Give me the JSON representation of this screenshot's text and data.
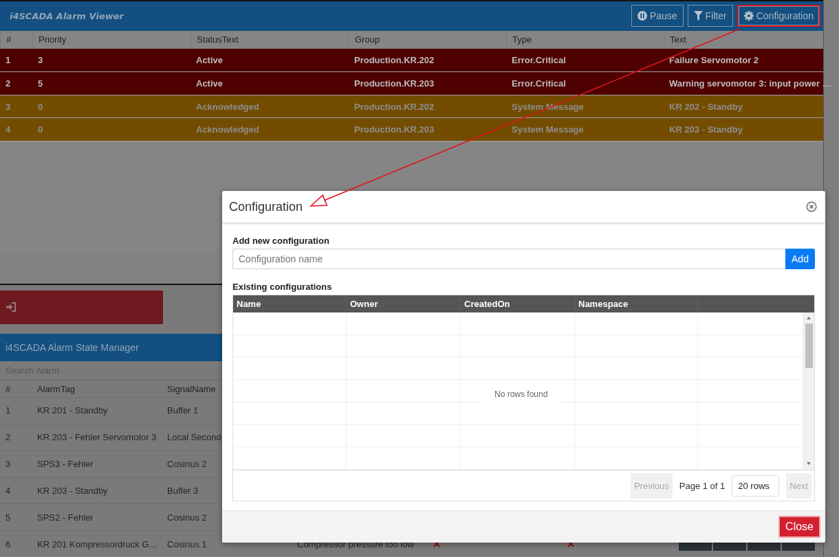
{
  "alarm_viewer": {
    "title": "i4SCADA Alarm Viewer",
    "toolbar": [
      {
        "label": "Pause",
        "kind": "pause",
        "highlighted": false
      },
      {
        "label": "Filter",
        "kind": "filter",
        "highlighted": false
      },
      {
        "label": "Configuration",
        "kind": "settings",
        "highlighted": true
      }
    ],
    "columns": [
      "#",
      "Priority",
      "StatusText",
      "Group",
      "Type",
      "Text"
    ],
    "rows": [
      {
        "kind": "critical",
        "cells": [
          "1",
          "3",
          "Active",
          "Production.KR.202",
          "Error.Critical",
          "Failure Servomotor 2"
        ]
      },
      {
        "kind": "critical",
        "cells": [
          "2",
          "5",
          "Active",
          "Production.KR.203",
          "Error.Critical",
          "Warning servomotor 3: input power …"
        ]
      },
      {
        "kind": "message",
        "cells": [
          "3",
          "0",
          "Acknowledged",
          "Production.KR.202",
          "System Message",
          "KR 202 - Standby"
        ]
      },
      {
        "kind": "message",
        "cells": [
          "4",
          "0",
          "Acknowledged",
          "Production.KR.203",
          "System Message",
          "KR 203 - Standby"
        ]
      }
    ]
  },
  "state_manager": {
    "title": "i4SCADA Alarm State Manager",
    "search": {
      "placeholder": "Search Alarm"
    },
    "columns": [
      "#",
      "AlarmTag",
      "SignalName"
    ],
    "rows": [
      {
        "cells": [
          "1",
          "KR 201 - Standby",
          "Buffer 1"
        ]
      },
      {
        "cells": [
          "2",
          "KR 203 - Fehler Servomotor 3",
          "Local Second"
        ]
      },
      {
        "cells": [
          "3",
          "SPS3 - Fehler",
          "Cosinus 2"
        ]
      },
      {
        "cells": [
          "4",
          "KR 203 - Standby",
          "Buffer 3"
        ]
      },
      {
        "cells": [
          "5",
          "SPS2 - Fehler",
          "Cosinus 2"
        ]
      },
      {
        "cells": [
          "6",
          "KR 201 Kompressordruck G…",
          "Cosinus 1"
        ],
        "message": "Compressor pressure too low",
        "mode_buttons_visible": true
      }
    ]
  },
  "dialog": {
    "title": "Configuration",
    "add_label": "Add new configuration",
    "name_field": {
      "placeholder": "Configuration name"
    },
    "add_button": "Add",
    "existing_label": "Existing configurations",
    "grid": {
      "columns": [
        "Name",
        "Owner",
        "CreatedOn",
        "Namespace"
      ],
      "empty_text": "No rows found"
    },
    "pager": {
      "previous": "Previous",
      "page": "Page 1 of 1",
      "rows": "20 rows",
      "next": "Next"
    },
    "close_button": "Close"
  }
}
